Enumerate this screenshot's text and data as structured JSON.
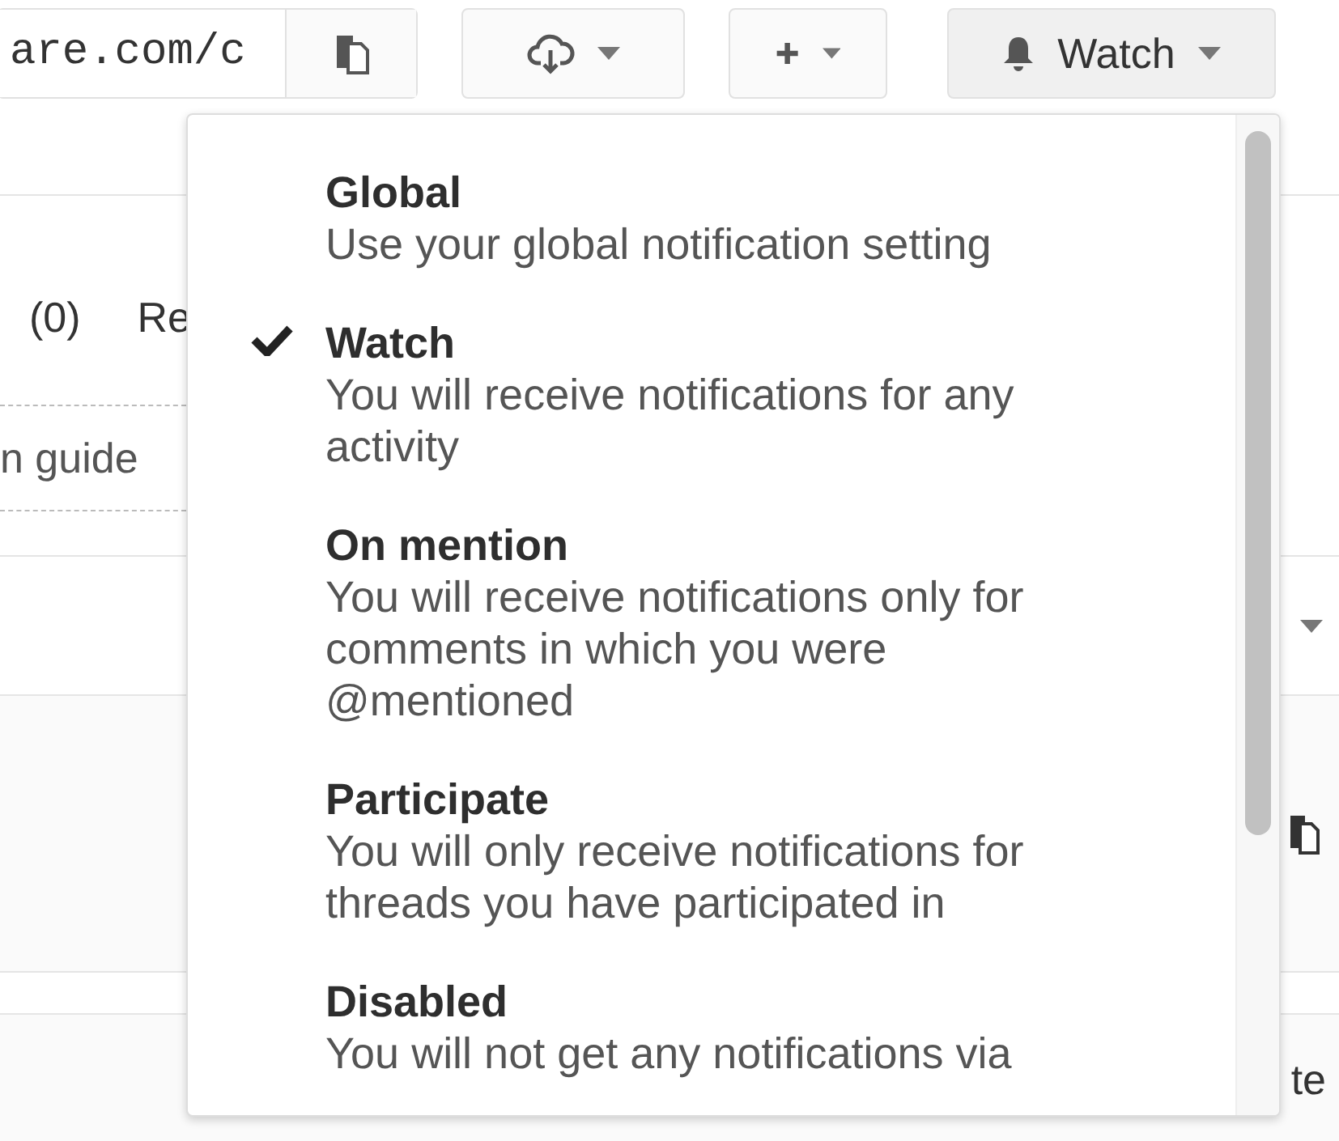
{
  "toolbar": {
    "url_field": {
      "value": "are.com/c"
    },
    "watch_button": {
      "label": "Watch"
    }
  },
  "background": {
    "count_text": "(0)",
    "cut_tab": "Re",
    "guide_link": "n guide",
    "cut_text": "te"
  },
  "watch_menu": {
    "items": [
      {
        "title": "Global",
        "description": "Use your global notification setting",
        "selected": false
      },
      {
        "title": "Watch",
        "description": "You will receive notifications for any activity",
        "selected": true
      },
      {
        "title": "On mention",
        "description": "You will receive notifications only for comments in which you were @mentioned",
        "selected": false
      },
      {
        "title": "Participate",
        "description": "You will only receive notifications for threads you have participated in",
        "selected": false
      },
      {
        "title": "Disabled",
        "description": "You will not get any notifications via",
        "selected": false
      }
    ]
  }
}
